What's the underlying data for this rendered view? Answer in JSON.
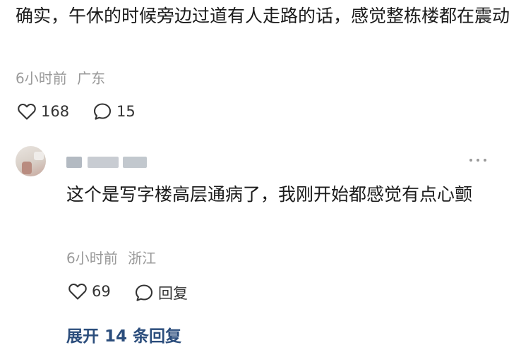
{
  "comment": {
    "text": "确实，午休的时候旁边过道有人走路的话，感觉整栋楼都在震动",
    "time": "6小时前",
    "location": "广东",
    "likes": "168",
    "replies": "15"
  },
  "reply": {
    "text": "这个是写字楼高层通病了，我刚开始都感觉有点心颤",
    "time": "6小时前",
    "location": "浙江",
    "likes": "69",
    "reply_label": "回复"
  },
  "expand_label": "展开 14 条回复",
  "icons": {
    "like": "heart-outline-icon",
    "comment": "speech-bubble-icon",
    "more": "more-dots-icon"
  }
}
